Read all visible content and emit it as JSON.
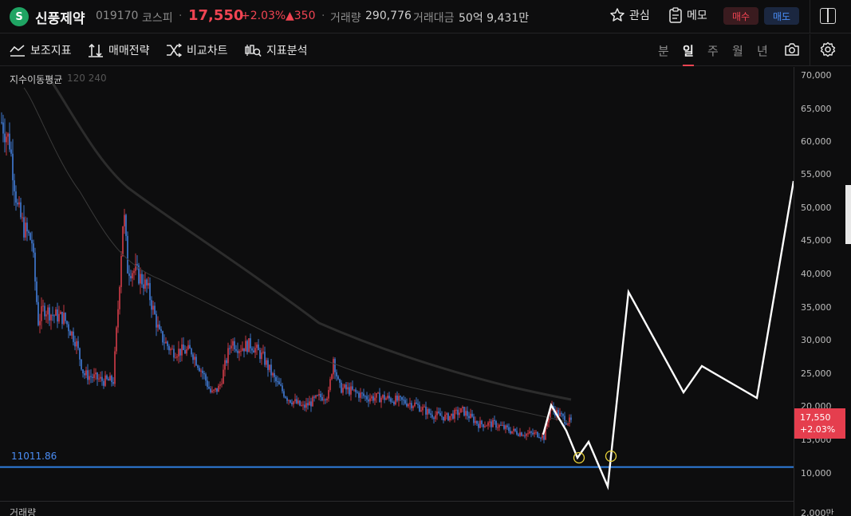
{
  "header": {
    "logo_glyph": "S",
    "stock_name": "신풍제약",
    "stock_code": "019170",
    "market": "코스피",
    "price": "17,550",
    "change_pct": "+2.03%",
    "change_abs": "▲350",
    "volume_label": "거래량",
    "volume_value": "290,776",
    "amount_label": "거래대금",
    "amount_value": "50억 9,431만",
    "watch_label": "관심",
    "memo_label": "메모",
    "buy_label": "매수",
    "sell_label": "매도"
  },
  "toolbar": {
    "indicators_label": "보조지표",
    "strategy_label": "매매전략",
    "compare_label": "비교차트",
    "analysis_label": "지표분석",
    "periods": [
      "분",
      "일",
      "주",
      "월",
      "년"
    ],
    "active_period": "일"
  },
  "chart": {
    "ma_label": "지수이동평균",
    "ma_periods": "120 240",
    "hline_value": "11011.86",
    "volume_section_label": "거래량",
    "y_ticks": [
      "70,000",
      "65,000",
      "60,000",
      "55,000",
      "50,000",
      "45,000",
      "40,000",
      "35,000",
      "30,000",
      "25,000",
      "20,000",
      "15,000",
      "10,000",
      "2,000만"
    ],
    "current_price_tag": "17,550",
    "current_change_tag": "+2.03%",
    "colors": {
      "up": "#f04452",
      "down": "#4a8df5",
      "hline": "#2f7fe0",
      "drawing": "#ffffff",
      "marker": "#e8d23a"
    }
  }
}
